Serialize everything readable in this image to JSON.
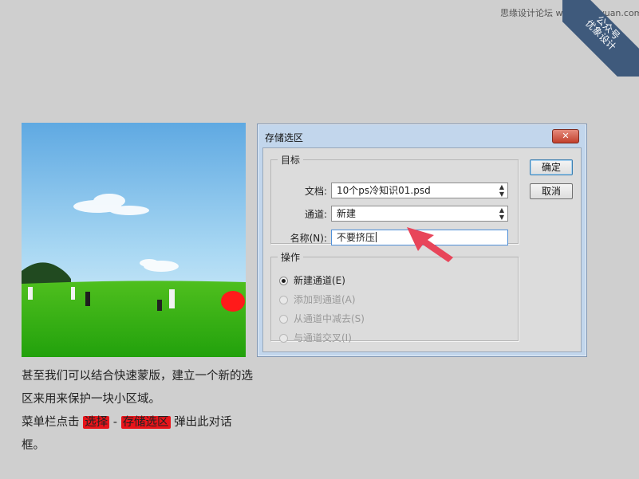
{
  "site_credit": "思缘设计论坛 www.missyuan.com",
  "ribbon": {
    "line1": "公众号",
    "line2": "优象设计"
  },
  "caption": {
    "line1": "甚至我们可以结合快速蒙版，建立一个新的选区来用来保护一块小区域。",
    "line2_prefix": "菜单栏点击 ",
    "menu_select": "选择",
    "separator": " - ",
    "menu_save_selection": "存储选区",
    "line2_suffix": " 弹出此对话框。"
  },
  "dialog": {
    "title": "存储选区",
    "close_glyph": "✕",
    "target_group": {
      "legend": "目标",
      "document_label": "文档:",
      "document_value": "10个ps冷知识01.psd",
      "channel_label": "通道:",
      "channel_value": "新建",
      "name_label": "名称(N):",
      "name_value": "不要挤压"
    },
    "operation_group": {
      "legend": "操作",
      "options": [
        {
          "label": "新建通道(E)",
          "checked": true,
          "enabled": true
        },
        {
          "label": "添加到通道(A)",
          "checked": false,
          "enabled": false
        },
        {
          "label": "从通道中减去(S)",
          "checked": false,
          "enabled": false
        },
        {
          "label": "与通道交叉(I)",
          "checked": false,
          "enabled": false
        }
      ]
    },
    "ok_label": "确定",
    "cancel_label": "取消"
  },
  "colors": {
    "highlight": "#e8141a",
    "arrow": "#e8455a",
    "dialog_frame": "#c2d6ec"
  }
}
